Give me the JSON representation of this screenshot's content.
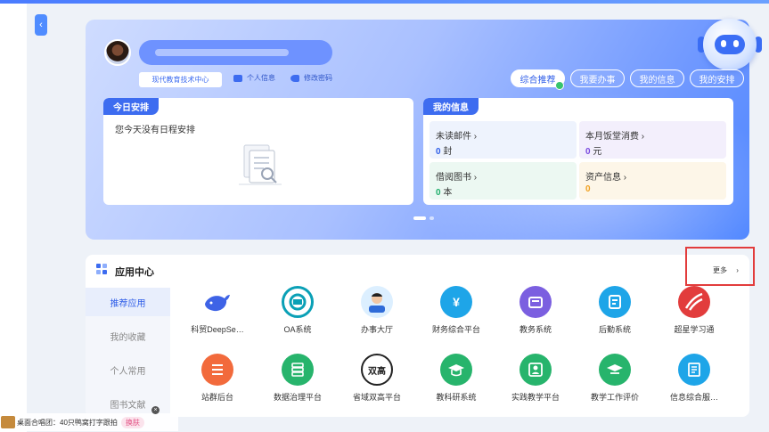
{
  "header": {
    "department": "现代教育技术中心",
    "personal_info": "个人信息",
    "change_password": "修改密码"
  },
  "tabs": [
    {
      "label": "综合推荐",
      "active": true
    },
    {
      "label": "我要办事",
      "active": false
    },
    {
      "label": "我的信息",
      "active": false
    },
    {
      "label": "我的安排",
      "active": false
    }
  ],
  "today": {
    "tag": "今日安排",
    "empty_text": "您今天没有日程安排"
  },
  "myinfo": {
    "tag": "我的信息",
    "tiles": [
      {
        "title": "未读邮件",
        "value": "0",
        "unit": "封",
        "color": "#2f5ee8",
        "bg": "#eef3fd"
      },
      {
        "title": "本月饭堂消费",
        "value": "0",
        "unit": "元",
        "color": "#7a4ae0",
        "bg": "#f3effc"
      },
      {
        "title": "借阅图书",
        "value": "0",
        "unit": "本",
        "color": "#1fae6b",
        "bg": "#ecf8f2"
      },
      {
        "title": "资产信息",
        "value": "0",
        "unit": "",
        "color": "#f0a020",
        "bg": "#fdf6e8"
      }
    ]
  },
  "app_center": {
    "title": "应用中心",
    "more": "更多",
    "nav": [
      "推荐应用",
      "我的收藏",
      "个人常用",
      "图书文献"
    ],
    "apps_row1": [
      {
        "label": "科贸DeepSe…",
        "icon": "whale-icon",
        "color": "#ffffff"
      },
      {
        "label": "OA系统",
        "icon": "oa-icon",
        "color": "#0aa0b6"
      },
      {
        "label": "办事大厅",
        "icon": "service-hall-icon",
        "color": "#7cc0e8"
      },
      {
        "label": "财务综合平台",
        "icon": "finance-icon",
        "color": "#1ea5e8"
      },
      {
        "label": "教务系统",
        "icon": "academic-icon",
        "color": "#7b5fe0"
      },
      {
        "label": "后勤系统",
        "icon": "logistics-icon",
        "color": "#1ea5e8"
      },
      {
        "label": "超星学习通",
        "icon": "chaoxing-icon",
        "color": "#e23c3c"
      }
    ],
    "apps_row2": [
      {
        "label": "站群后台",
        "icon": "site-group-icon",
        "color": "#f26a3c"
      },
      {
        "label": "数据治理平台",
        "icon": "data-governance-icon",
        "color": "#27b46c"
      },
      {
        "label": "省域双高平台",
        "icon": "double-high-icon",
        "color": "#222222"
      },
      {
        "label": "教科研系统",
        "icon": "research-icon",
        "color": "#27b46c"
      },
      {
        "label": "实践教学平台",
        "icon": "practice-icon",
        "color": "#27b46c"
      },
      {
        "label": "教学工作评价",
        "icon": "evaluation-icon",
        "color": "#27b46c"
      },
      {
        "label": "信息综合服…",
        "icon": "info-service-icon",
        "color": "#1ea5e8"
      }
    ],
    "double_high_text": "双高"
  },
  "ticker": {
    "text": "桌面合唱团：40只鸭窝打字跟拍",
    "button": "换肤"
  }
}
